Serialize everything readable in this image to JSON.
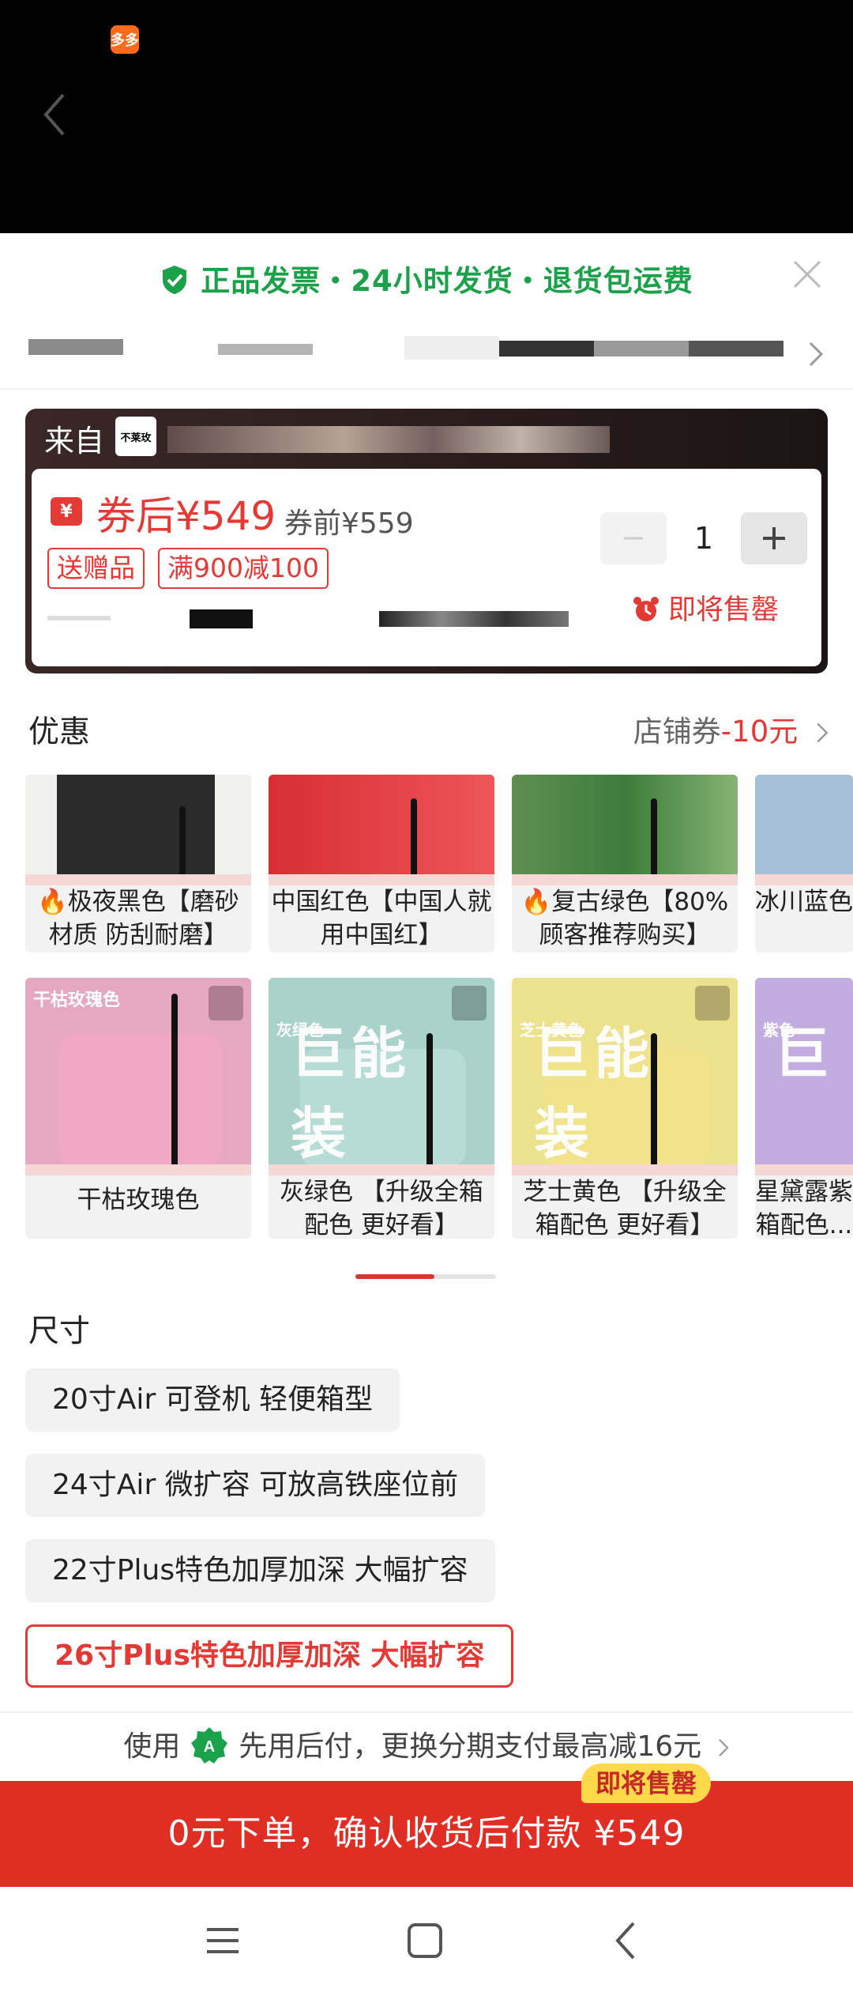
{
  "app": {
    "badge": "多多",
    "colors": {
      "accent": "#e53935",
      "green": "#1aa14a",
      "buy": "#e02e24"
    }
  },
  "guarantee": {
    "text": "正品发票・24小时发货・退货包运费"
  },
  "store_card": {
    "from_label": "来自",
    "logo_text": "不莱玫",
    "price_after": "券后¥549",
    "price_before": "券前¥559",
    "tags": [
      "送赠品",
      "满900减100"
    ],
    "quantity": "1",
    "sell_soon": "即将售罄"
  },
  "promo": {
    "label": "优惠",
    "coupon_prefix": "店铺券",
    "coupon_value": "-10元"
  },
  "colors_row1": [
    {
      "name": "极夜黑色【磨砂材质 防刮耐磨】",
      "hot": true,
      "color": "#2b2b2b"
    },
    {
      "name": "中国红色【中国人就用中国红】",
      "hot": false,
      "color": "#e0393e"
    },
    {
      "name": "复古绿色【80%顾客推荐购买】",
      "hot": true,
      "color": "#3d7c3c"
    },
    {
      "name": "冰川蓝色【静 气...",
      "hot": false,
      "color": "#a6bfd8"
    }
  ],
  "colors_row2": [
    {
      "name": "干枯玫瑰色",
      "badge": "干枯玫瑰色",
      "big": "",
      "color": "#e9a3bf",
      "bg": "#e6a8c0"
    },
    {
      "name": "灰绿色 【升级全箱配色 更好看】",
      "badge": "灰绿色",
      "big": "巨能 装",
      "color": "#b7dcd6",
      "bg": "#a9d2cb"
    },
    {
      "name": "芝士黄色 【升级全箱配色 更好看】",
      "badge": "芝士黄色",
      "big": "巨能 装",
      "color": "#f1e38a",
      "bg": "#ece18c"
    },
    {
      "name": "星黛露紫 箱配色...",
      "badge": "紫色",
      "big": "巨",
      "color": "#c8b4e3",
      "bg": "#c1addf"
    }
  ],
  "size": {
    "label": "尺寸",
    "options": [
      "20寸Air 可登机  轻便箱型",
      "24寸Air 微扩容 可放高铁座位前",
      "22寸Plus特色加厚加深 大幅扩容",
      "26寸Plus特色加厚加深 大幅扩容"
    ],
    "selected_index": 3
  },
  "pay": {
    "use": "使用",
    "text": "先用后付，更换分期支付最高减16元",
    "buy_button": "0元下单，确认收货后付款 ¥549",
    "sell_pill": "即将售罄"
  }
}
